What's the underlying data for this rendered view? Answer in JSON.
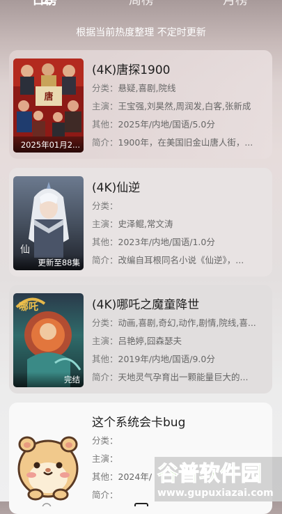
{
  "tabs": [
    "日榜",
    "周榜",
    "月榜"
  ],
  "subtitle": "根据当前热度整理 不定时更新",
  "labels": {
    "genre": "分类：",
    "cast": "主演：",
    "other": "其他：",
    "intro": "简介："
  },
  "items": [
    {
      "title": "(4K)唐探1900",
      "poster_caption": "2025年01月2...",
      "genre": "悬疑,喜剧,院线",
      "cast": "王宝强,刘昊然,周润发,白客,张新成",
      "other": "2025年/内地/国语/5.0分",
      "intro": "1900年，在美国旧金山唐人街，..."
    },
    {
      "title": "(4K)仙逆",
      "poster_caption": "更新至88集",
      "genre": "",
      "cast": "史泽鲲,常文涛",
      "other": "2023年/内地/国语/1.0分",
      "intro": "改编自耳根同名小说《仙逆》，..."
    },
    {
      "title": "(4K)哪吒之魔童降世",
      "poster_caption": "完结",
      "genre": "动画,喜剧,奇幻,动作,剧情,院线,喜...",
      "cast": "吕艳婷,囧森瑟夫",
      "other": "2019年/内地/国语/9.0分",
      "intro": "天地灵气孕育出一颗能量巨大的..."
    },
    {
      "title": "这个系统会卡bug",
      "poster_caption": "",
      "genre": "",
      "cast": "",
      "other": "2024年/",
      "intro": ""
    }
  ],
  "watermark": {
    "brand": "谷普软件园",
    "url": "www.gupuxiazai.com"
  },
  "colors": {
    "accent_green": "#5fb82e",
    "watermark_text": "#ffffff"
  }
}
